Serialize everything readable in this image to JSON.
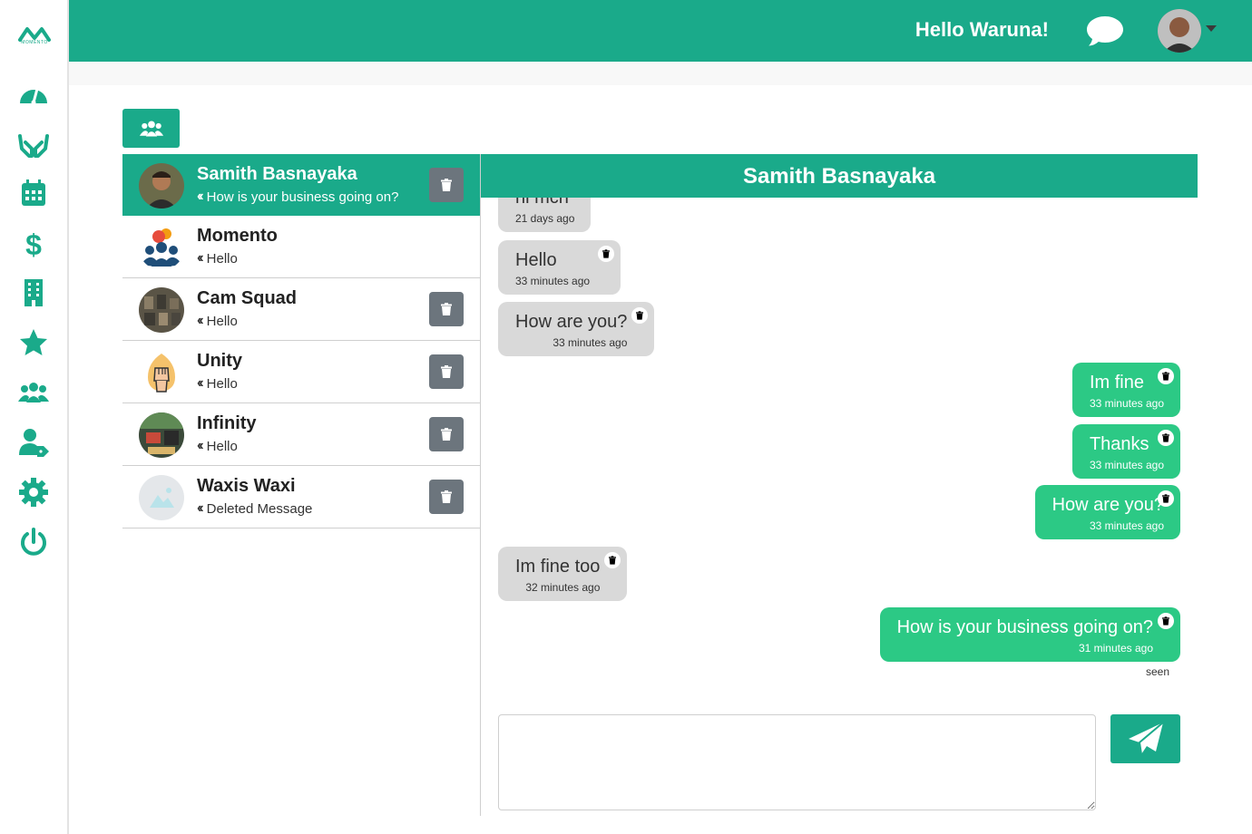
{
  "brand": {
    "logo_text": "MOMENTO",
    "accent": "#1aaa8a",
    "sent_bubble": "#2cc985",
    "received_bubble": "#d9d9d9"
  },
  "sidebar": {
    "items": [
      {
        "icon": "dashboard-gauge-icon"
      },
      {
        "icon": "hands-icon"
      },
      {
        "icon": "calendar-icon"
      },
      {
        "icon": "dollar-icon"
      },
      {
        "icon": "building-icon"
      },
      {
        "icon": "star-icon"
      },
      {
        "icon": "users-icon"
      },
      {
        "icon": "user-tag-icon"
      },
      {
        "icon": "gear-icon"
      },
      {
        "icon": "power-icon"
      }
    ]
  },
  "header": {
    "greeting": "Hello Waruna!",
    "chat_icon": "comment-icon",
    "avatar": "user-avatar"
  },
  "groups_button": {
    "icon": "users-icon"
  },
  "conversations": [
    {
      "name": "Samith Basnayaka",
      "last": "How is your business going on?",
      "active": true
    },
    {
      "name": "Momento",
      "last": "Hello"
    },
    {
      "name": "Cam Squad",
      "last": "Hello"
    },
    {
      "name": "Unity",
      "last": "Hello"
    },
    {
      "name": "Infinity",
      "last": "Hello"
    },
    {
      "name": "Waxis Waxi",
      "last": "Deleted Message"
    }
  ],
  "chat": {
    "title": "Samith Basnayaka",
    "messages": [
      {
        "text": "hi mch",
        "time": "21 days ago",
        "dir": "in"
      },
      {
        "text": "Hello",
        "time": "33 minutes ago",
        "dir": "in"
      },
      {
        "text": "How are you?",
        "time": "33 minutes ago",
        "dir": "in"
      },
      {
        "text": "Im fine",
        "time": "33 minutes ago",
        "dir": "out"
      },
      {
        "text": "Thanks",
        "time": "33 minutes ago",
        "dir": "out"
      },
      {
        "text": "How are you?",
        "time": "33 minutes ago",
        "dir": "out"
      },
      {
        "text": "Im fine too",
        "time": "32 minutes ago",
        "dir": "in"
      },
      {
        "text": "How is your business going on?",
        "time": "31 minutes ago",
        "dir": "out"
      }
    ],
    "seen": "seen",
    "input_value": "",
    "send_icon": "paper-plane-icon"
  }
}
